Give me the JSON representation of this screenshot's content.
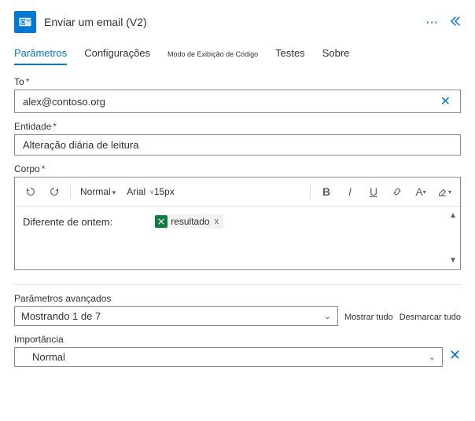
{
  "header": {
    "title": "Enviar um email (V2)"
  },
  "tabs": {
    "params": "Parâmetros",
    "settings": "Configurações",
    "codeview": "Modo de Exibição de Código",
    "tests": "Testes",
    "about": "Sobre"
  },
  "fields": {
    "to": {
      "label": "To",
      "value": "alex@contoso.org"
    },
    "entity": {
      "label": "Entidade",
      "value": "Alteração diária de leitura"
    },
    "body": {
      "label": "Corpo",
      "text_prefix": "Diferente de ontem:",
      "token_label": "resultado"
    }
  },
  "toolbar": {
    "style": "Normal",
    "font": "Arial",
    "size": "15px"
  },
  "advanced": {
    "label": "Parâmetros avançados",
    "showing": "Mostrando 1 de 7",
    "show_all": "Mostrar tudo",
    "clear_all": "Desmarcar tudo"
  },
  "importance": {
    "label": "Importância",
    "value": "Normal"
  }
}
